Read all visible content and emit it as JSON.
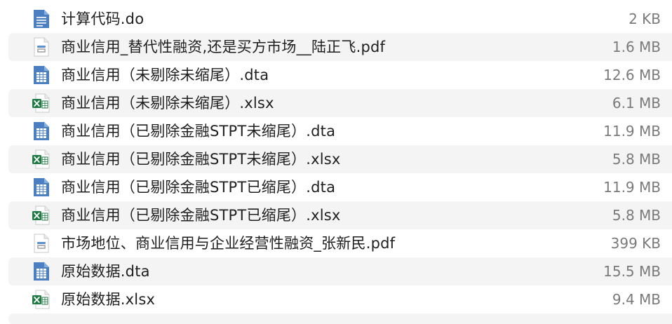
{
  "files": [
    {
      "name": "计算代码.do",
      "size": "2 KB",
      "icon": "do-file-icon",
      "striped": false
    },
    {
      "name": "商业信用_替代性融资,还是买方市场__陆正飞.pdf",
      "size": "1.6 MB",
      "icon": "pdf-file-icon",
      "striped": true
    },
    {
      "name": "商业信用（未剔除未缩尾）.dta",
      "size": "12.6 MB",
      "icon": "dta-file-icon",
      "striped": false
    },
    {
      "name": "商业信用（未剔除未缩尾）.xlsx",
      "size": "6.1 MB",
      "icon": "excel-file-icon",
      "striped": true
    },
    {
      "name": "商业信用（已剔除金融STPT未缩尾）.dta",
      "size": "11.9 MB",
      "icon": "dta-file-icon",
      "striped": false
    },
    {
      "name": "商业信用（已剔除金融STPT未缩尾）.xlsx",
      "size": "5.8 MB",
      "icon": "excel-file-icon",
      "striped": true
    },
    {
      "name": "商业信用（已剔除金融STPT已缩尾）.dta",
      "size": "11.9 MB",
      "icon": "dta-file-icon",
      "striped": false
    },
    {
      "name": "商业信用（已剔除金融STPT已缩尾）.xlsx",
      "size": "5.8 MB",
      "icon": "excel-file-icon",
      "striped": true
    },
    {
      "name": "市场地位、商业信用与企业经营性融资_张新民.pdf",
      "size": "399 KB",
      "icon": "pdf-file-icon",
      "striped": false
    },
    {
      "name": "原始数据.dta",
      "size": "15.5 MB",
      "icon": "dta-file-icon",
      "striped": true
    },
    {
      "name": "原始数据.xlsx",
      "size": "9.4 MB",
      "icon": "excel-file-icon",
      "striped": false
    }
  ],
  "colors": {
    "stripe": "#f4f4f4",
    "doc_blue": "#4a7fc1",
    "excel_green": "#1f7a44",
    "size_gray": "#7a7a7a"
  }
}
